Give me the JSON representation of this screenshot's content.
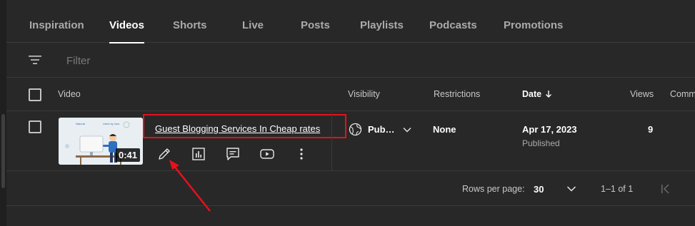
{
  "tabs": [
    {
      "label": "Inspiration"
    },
    {
      "label": "Videos"
    },
    {
      "label": "Shorts"
    },
    {
      "label": "Live"
    },
    {
      "label": "Posts"
    },
    {
      "label": "Playlists"
    },
    {
      "label": "Podcasts"
    },
    {
      "label": "Promotions"
    }
  ],
  "active_tab": "Videos",
  "filter": {
    "placeholder": "Filter",
    "value": ""
  },
  "columns": {
    "video": "Video",
    "visibility": "Visibility",
    "restrictions": "Restrictions",
    "date": "Date",
    "views": "Views",
    "comments": "Comm"
  },
  "sort": {
    "column": "Date",
    "direction": "descending"
  },
  "rows": [
    {
      "title": "Guest Blogging Services In Cheap rates",
      "duration": "0:41",
      "visibility": "Pub…",
      "restrictions": "None",
      "date": "Apr 17, 2023",
      "date_status": "Published",
      "views": "9",
      "thumbnail_text_1": "Natural",
      "thumbnail_text_2": "Used by now"
    }
  ],
  "pagination": {
    "rows_per_page_label": "Rows per page:",
    "rows_per_page": "30",
    "range": "1–1 of 1"
  },
  "colors": {
    "background": "#282828",
    "divider": "#3a3a3a",
    "annotation_red": "#e8101b",
    "text_secondary": "#aaaaaa"
  },
  "icons": [
    "filter-icon",
    "edit-pencil-icon",
    "analytics-icon",
    "comments-icon",
    "youtube-play-icon",
    "more-vert-icon",
    "globe-icon",
    "chevron-down-icon",
    "arrow-down-icon",
    "first-page-icon"
  ]
}
